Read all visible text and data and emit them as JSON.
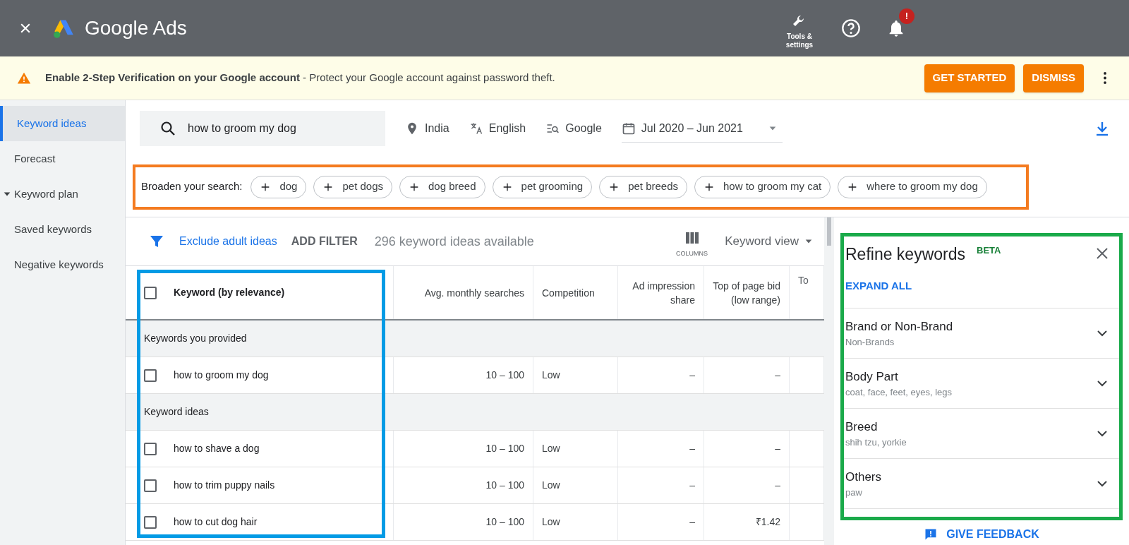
{
  "app": {
    "title": "Google Ads"
  },
  "header_actions": [
    {
      "kind": "tools",
      "label": "Tools & settings"
    },
    {
      "kind": "help"
    },
    {
      "kind": "notifications",
      "badge": "!"
    }
  ],
  "banner": {
    "text": "**Enable 2-Step Verification on your Google account** - Protect your Google account against password theft.",
    "buttons": [
      "GET STARTED",
      "DISMISS"
    ]
  },
  "sidebar": {
    "items": [
      {
        "label": "Keyword ideas",
        "selected": true,
        "expandable": false
      },
      {
        "label": "Forecast",
        "selected": false,
        "expandable": false
      },
      {
        "label": "Keyword plan",
        "selected": false,
        "expandable": true
      },
      {
        "label": "Saved keywords",
        "selected": false,
        "expandable": false
      },
      {
        "label": "Negative keywords",
        "selected": false,
        "expandable": false
      }
    ]
  },
  "search": {
    "value": "how to groom my dog",
    "filters": [
      {
        "kind": "location",
        "label": "India"
      },
      {
        "kind": "language",
        "label": "English"
      },
      {
        "kind": "network",
        "label": "Google"
      },
      {
        "kind": "date",
        "label": "Jul 2020 – Jun 2021"
      }
    ]
  },
  "broaden": {
    "label": "Broaden your search:",
    "chips": [
      "dog",
      "pet dogs",
      "dog breed",
      "pet grooming",
      "pet breeds",
      "how to groom my cat",
      "where to groom my dog"
    ]
  },
  "toolbar": {
    "exclude_link": "Exclude adult ideas",
    "add_filter": "ADD FILTER",
    "count": "296 keyword ideas available",
    "columns_label": "COLUMNS",
    "view": "Keyword view"
  },
  "table": {
    "columns": [
      "Keyword (by relevance)",
      "Avg. monthly searches",
      "Competition",
      "Ad impression share",
      "Top of page bid (low range)",
      "To"
    ],
    "rows": [
      {
        "kind": "group",
        "label": "Keywords you provided"
      },
      {
        "kind": "keyword",
        "checked": false,
        "cells": [
          "how to groom my dog",
          "10 – 100",
          "Low",
          "–",
          "–"
        ]
      },
      {
        "kind": "group",
        "label": "Keyword ideas"
      },
      {
        "kind": "keyword",
        "checked": false,
        "cells": [
          "how to shave a dog",
          "10 – 100",
          "Low",
          "–",
          "–"
        ]
      },
      {
        "kind": "keyword",
        "checked": false,
        "cells": [
          "how to trim puppy nails",
          "10 – 100",
          "Low",
          "–",
          "–"
        ]
      },
      {
        "kind": "keyword",
        "checked": false,
        "cells": [
          "how to cut dog hair",
          "10 – 100",
          "Low",
          "–",
          "₹1.42"
        ]
      }
    ],
    "select_all": {
      "checked": false
    }
  },
  "refine": {
    "title": "Refine keywords",
    "badge": "BETA",
    "expand_all": "EXPAND ALL",
    "groups": [
      {
        "name": "Brand or Non-Brand",
        "summary": "Non-Brands"
      },
      {
        "name": "Body Part",
        "summary": "coat, face, feet, eyes, legs"
      },
      {
        "name": "Breed",
        "summary": "shih tzu, yorkie"
      },
      {
        "name": "Others",
        "summary": "paw"
      }
    ],
    "feedback": "GIVE FEEDBACK"
  },
  "highlights": [
    {
      "kind": "broaden",
      "color": "#f47b20"
    },
    {
      "kind": "keywords",
      "color": "#039be5"
    },
    {
      "kind": "refine",
      "color": "#1aaa4a"
    }
  ]
}
